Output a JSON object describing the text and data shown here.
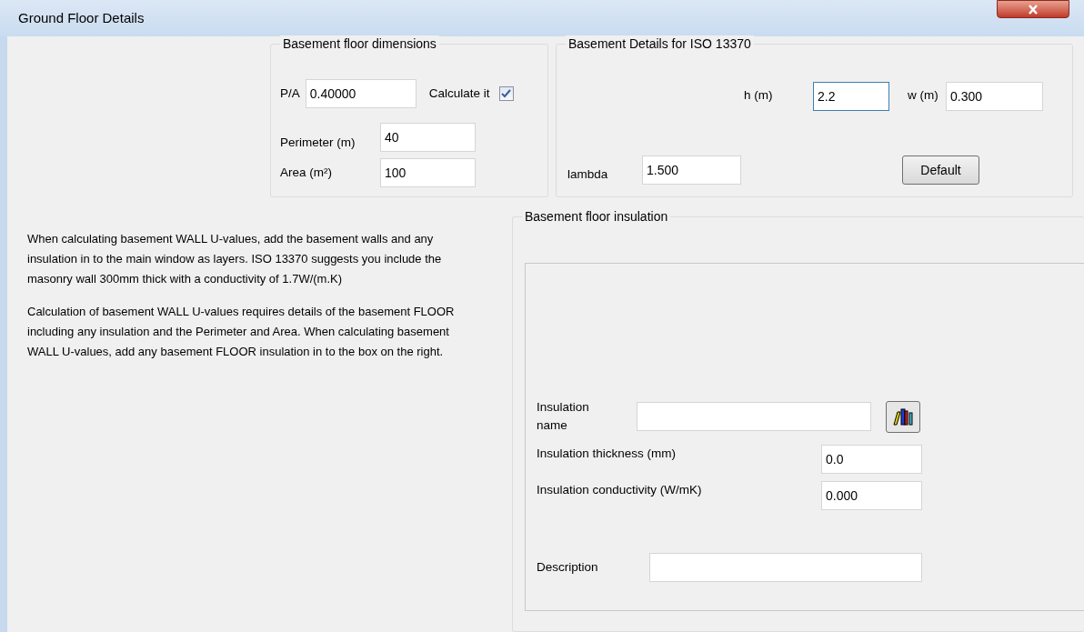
{
  "window": {
    "title": "Ground Floor Details"
  },
  "dimensions": {
    "title": "Basement floor dimensions",
    "pa": {
      "label": "P/A",
      "value": "0.40000"
    },
    "calculate": {
      "label": "Calculate it",
      "checked": true
    },
    "perimeter": {
      "label": "Perimeter (m)",
      "value": "40"
    },
    "area": {
      "label": "Area (m²)",
      "value": "100"
    }
  },
  "iso_details": {
    "title": "Basement Details for ISO 13370",
    "h": {
      "label": "h (m)",
      "value": "2.2",
      "focused": true
    },
    "w": {
      "label": "w (m)",
      "value": "0.300",
      "focused": false
    },
    "lambda": {
      "label": "lambda",
      "value": "1.500",
      "focused": false
    },
    "default_button": "Default"
  },
  "notes": [
    "When calculating basement WALL U-values, add the basement walls and any insulation in to the main window as layers. ISO 13370 suggests you include the masonry wall 300mm thick with a conductivity of 1.7W/(m.K)",
    "Calculation of basement WALL U-values requires details of the basement FLOOR including any insulation and the Perimeter and Area. When calculating basement WALL U-values, add any basement FLOOR insulation in to the box on the right."
  ],
  "insulation": {
    "title": "Basement floor insulation",
    "name": {
      "label": "Insulation name"
    },
    "thickness": {
      "label": "Insulation thickness (mm)",
      "value": "0.0"
    },
    "conductivity": {
      "label": "Insulation conductivity (W/mK)",
      "value": "0.000"
    },
    "description": {
      "label": "Description"
    }
  }
}
